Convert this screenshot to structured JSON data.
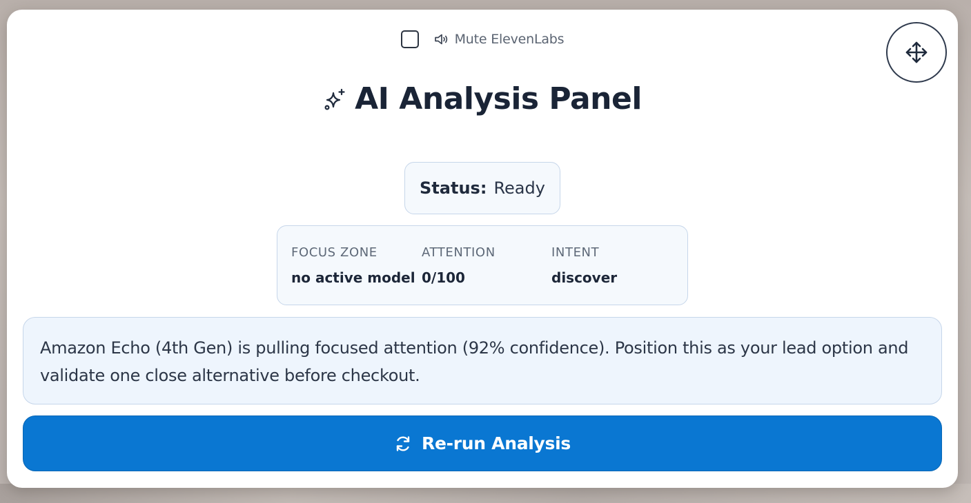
{
  "header": {
    "mute_checked": false,
    "mute_label": "Mute ElevenLabs",
    "mute_icon": "speaker-icon",
    "move_icon": "move-arrows-icon"
  },
  "panel": {
    "title": "AI Analysis Panel",
    "title_icon": "sparkle-icon"
  },
  "status": {
    "label": "Status:",
    "value": "Ready"
  },
  "metrics": [
    {
      "label": "FOCUS ZONE",
      "value": "no active model"
    },
    {
      "label": "ATTENTION",
      "value": "0/100"
    },
    {
      "label": "INTENT",
      "value": "discover"
    }
  ],
  "insight": {
    "text": "Amazon Echo (4th Gen) is pulling focused attention (92% confidence). Position this as your lead option and validate one close alternative before checkout."
  },
  "actions": {
    "rerun_label": "Re-run Analysis",
    "rerun_icon": "refresh-icon"
  },
  "colors": {
    "accent": "#0a77d2",
    "title": "#1a2436",
    "card_border": "#c6d6ea",
    "card_bg": "#f5f9fd",
    "insight_bg": "#eef5fd"
  }
}
